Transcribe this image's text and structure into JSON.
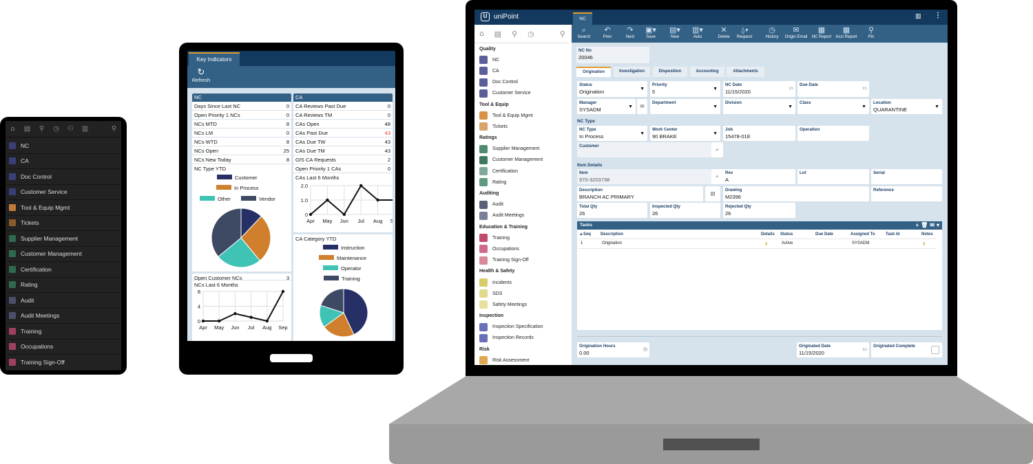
{
  "phone": {
    "toolbar_icons": [
      "home-icon",
      "card-icon",
      "pin-icon",
      "history-icon",
      "user-icon",
      "chart-icon",
      "search-icon"
    ],
    "items": [
      {
        "label": "NC",
        "color": "#3a3f7a"
      },
      {
        "label": "CA",
        "color": "#3a3f7a"
      },
      {
        "label": "Doc Control",
        "color": "#3a3f7a"
      },
      {
        "label": "Customer Service",
        "color": "#3a3f7a"
      },
      {
        "label": "Tool & Equip Mgmt",
        "color": "#c07a3a"
      },
      {
        "label": "Tickets",
        "color": "#8a5a2a"
      },
      {
        "label": "Supplier Management",
        "color": "#2e6a4f"
      },
      {
        "label": "Customer Management",
        "color": "#2e6a4f"
      },
      {
        "label": "Certification",
        "color": "#2e6a4f"
      },
      {
        "label": "Rating",
        "color": "#2e6a4f"
      },
      {
        "label": "Audit",
        "color": "#4a4f6a"
      },
      {
        "label": "Audit Meetings",
        "color": "#4a4f6a"
      },
      {
        "label": "Training",
        "color": "#a04060"
      },
      {
        "label": "Occupations",
        "color": "#a04060"
      },
      {
        "label": "Training Sign-Off",
        "color": "#a04060"
      }
    ]
  },
  "tablet": {
    "tab": "Key Indicators",
    "refresh_label": "Refresh",
    "nc": {
      "title": "NC",
      "rows": [
        [
          "Days Since Last NC",
          "0"
        ],
        [
          "Open Priority 1 NCs",
          "0"
        ],
        [
          "NCs MTD",
          "8"
        ],
        [
          "NCs LM",
          "0"
        ],
        [
          "NCs WTD",
          "8"
        ],
        [
          "NCs Open",
          "25"
        ],
        [
          "NCs New Today",
          "8"
        ]
      ],
      "open_customer": [
        "Open Customer NCs",
        "3"
      ]
    },
    "ca": {
      "title": "CA",
      "rows": [
        [
          "CA Reviews Past Due",
          "0"
        ],
        [
          "CA Reviews TM",
          "0"
        ],
        [
          "CAs Open",
          "48"
        ],
        [
          "CAs Past Due",
          "43"
        ],
        [
          "CAs Due TW",
          "43"
        ],
        [
          "CAs Due TM",
          "43"
        ],
        [
          "O/S CA Requests",
          "2"
        ],
        [
          "Open Priority 1 CAs",
          "0"
        ]
      ],
      "alert_color": "#e53935"
    }
  },
  "chart_data": [
    {
      "type": "pie",
      "title": "NC Type YTD",
      "categories": [
        "Customer",
        "In Process",
        "Other",
        "Vendor"
      ],
      "values": [
        12,
        27,
        25,
        36
      ],
      "colors": [
        "#262f66",
        "#d07f2c",
        "#3fc3b5",
        "#3e4a64"
      ]
    },
    {
      "type": "line",
      "title": "NCs Last 6 Months",
      "categories": [
        "Apr",
        "May",
        "Jun",
        "Jul",
        "Aug",
        "Sep"
      ],
      "values": [
        0,
        0,
        2,
        1,
        0,
        8
      ],
      "ylim": [
        0,
        8
      ],
      "yticks": [
        "0",
        "4",
        "8"
      ],
      "grid": true
    },
    {
      "type": "line",
      "title": "CAs Last 6 Months",
      "categories": [
        "Apr",
        "May",
        "Jun",
        "Jul",
        "Aug",
        "Sep"
      ],
      "values": [
        0,
        1,
        0,
        2,
        1,
        1
      ],
      "ylim": [
        0,
        2
      ],
      "yticks": [
        "0",
        "1.0",
        "2.0"
      ],
      "grid": true
    },
    {
      "type": "pie",
      "title": "CA Category YTD",
      "categories": [
        "Instruction",
        "Maintenance",
        "Operator",
        "Training"
      ],
      "values": [
        43,
        22,
        15,
        20
      ],
      "colors": [
        "#262f66",
        "#d07f2c",
        "#3fc3b5",
        "#3e4a64"
      ]
    }
  ],
  "laptop": {
    "app_title": "uniPoint",
    "doc_tab": "NC",
    "toolbar": [
      {
        "label": "Search",
        "icon": "⌕"
      },
      {
        "label": "Prev",
        "icon": "↶"
      },
      {
        "label": "Next",
        "icon": "↷"
      },
      {
        "label": "Save",
        "icon": "▣▾"
      },
      {
        "label": "New",
        "icon": "▤▾"
      },
      {
        "label": "Auto",
        "icon": "▥▾"
      },
      {
        "label": "Delete",
        "icon": "✕"
      },
      {
        "label": "Request",
        "icon": "⍙▾"
      },
      {
        "label": "History",
        "icon": "◷"
      },
      {
        "label": "Origin Email",
        "icon": "✉"
      },
      {
        "label": "NC Report",
        "icon": "▦"
      },
      {
        "label": "Acct Report",
        "icon": "▦"
      },
      {
        "label": "Pin",
        "icon": "⚲"
      }
    ],
    "sidebar": [
      {
        "h": "Quality"
      },
      {
        "label": "NC",
        "color": "#5a5f9a"
      },
      {
        "label": "CA",
        "color": "#5a5f9a"
      },
      {
        "label": "Doc Control",
        "color": "#5a5f9a"
      },
      {
        "label": "Customer Service",
        "color": "#5a5f9a"
      },
      {
        "h": "Tool & Equip"
      },
      {
        "label": "Tool & Equip Mgmt",
        "color": "#d9924a"
      },
      {
        "label": "Tickets",
        "color": "#d9a46a"
      },
      {
        "h": "Ratings"
      },
      {
        "label": "Supplier Management",
        "color": "#4f8a70"
      },
      {
        "label": "Customer Management",
        "color": "#3f7a60"
      },
      {
        "label": "Certification",
        "color": "#7fa898"
      },
      {
        "label": "Rating",
        "color": "#5f9a80"
      },
      {
        "h": "Auditing"
      },
      {
        "label": "Audit",
        "color": "#5a5f7a"
      },
      {
        "label": "Audit Meetings",
        "color": "#7a7f9a"
      },
      {
        "h": "Education & Training"
      },
      {
        "label": "Training",
        "color": "#c04a6a"
      },
      {
        "label": "Occupations",
        "color": "#d06a8a"
      },
      {
        "label": "Training Sign-Off",
        "color": "#d88a9a"
      },
      {
        "h": "Health & Safety"
      },
      {
        "label": "Incidents",
        "color": "#d8cc6a"
      },
      {
        "label": "SDS",
        "color": "#e0d88a"
      },
      {
        "label": "Safety Meetings",
        "color": "#e8e0a0"
      },
      {
        "h": "Inspection"
      },
      {
        "label": "Inspection Specification",
        "color": "#6a6fba"
      },
      {
        "label": "Inspection Records",
        "color": "#6a6fba"
      },
      {
        "h": "Risk"
      },
      {
        "label": "Risk Assessment",
        "color": "#e0a850"
      }
    ],
    "nc_no": {
      "label": "NC No",
      "value": "20046"
    },
    "tabs": [
      "Origination",
      "Investigation",
      "Disposition",
      "Accounting",
      "Attachments"
    ],
    "fields": {
      "status": {
        "label": "Status",
        "value": "Origination"
      },
      "priority": {
        "label": "Priority",
        "value": "5"
      },
      "nc_date": {
        "label": "NC Date",
        "value": "11/15/2020"
      },
      "due_date": {
        "label": "Due Date",
        "value": ""
      },
      "manager": {
        "label": "Manager",
        "value": "SYSADM"
      },
      "department": {
        "label": "Department",
        "value": ""
      },
      "division": {
        "label": "Division",
        "value": ""
      },
      "class": {
        "label": "Class",
        "value": ""
      },
      "location": {
        "label": "Location",
        "value": "QUARANTINE"
      },
      "nc_type": {
        "label": "NC Type",
        "value": "In Process"
      },
      "work_center": {
        "label": "Work Center",
        "value": "90 BRAKE"
      },
      "job": {
        "label": "Job",
        "value": "15478-01E"
      },
      "operation": {
        "label": "Operation",
        "value": ""
      },
      "customer": {
        "label": "Customer",
        "value": ""
      },
      "item": {
        "label": "Item",
        "value": "970-3203738"
      },
      "rev": {
        "label": "Rev",
        "value": "A"
      },
      "lot": {
        "label": "Lot",
        "value": ""
      },
      "serial": {
        "label": "Serial",
        "value": ""
      },
      "description": {
        "label": "Description",
        "value": "BRANCH AC PRIMARY"
      },
      "drawing": {
        "label": "Drawing",
        "value": "M2396"
      },
      "reference": {
        "label": "Reference",
        "value": ""
      },
      "total_qty": {
        "label": "Total Qty",
        "value": "26"
      },
      "inspected_qty": {
        "label": "Inspected Qty",
        "value": "26"
      },
      "rejected_qty": {
        "label": "Rejected Qty",
        "value": "26"
      },
      "origination_hours": {
        "label": "Origination Hours",
        "value": "0.00"
      },
      "originated_date": {
        "label": "Originated Date",
        "value": "11/15/2020"
      },
      "originated_complete": {
        "label": "Originated Complete",
        "checked": false
      }
    },
    "sections": {
      "nc_type": "NC Type",
      "item_details": "Item Details"
    },
    "tasks": {
      "title": "Tasks",
      "columns": [
        "▲Seq",
        "Description",
        "Details",
        "Status",
        "Due Date",
        "Assigned To",
        "Task Id",
        "Notes"
      ],
      "rows": [
        {
          "seq": "1",
          "description": "Origination",
          "status": "Active",
          "due_date": "",
          "assigned_to": "SYSADM",
          "task_id": ""
        }
      ]
    }
  }
}
